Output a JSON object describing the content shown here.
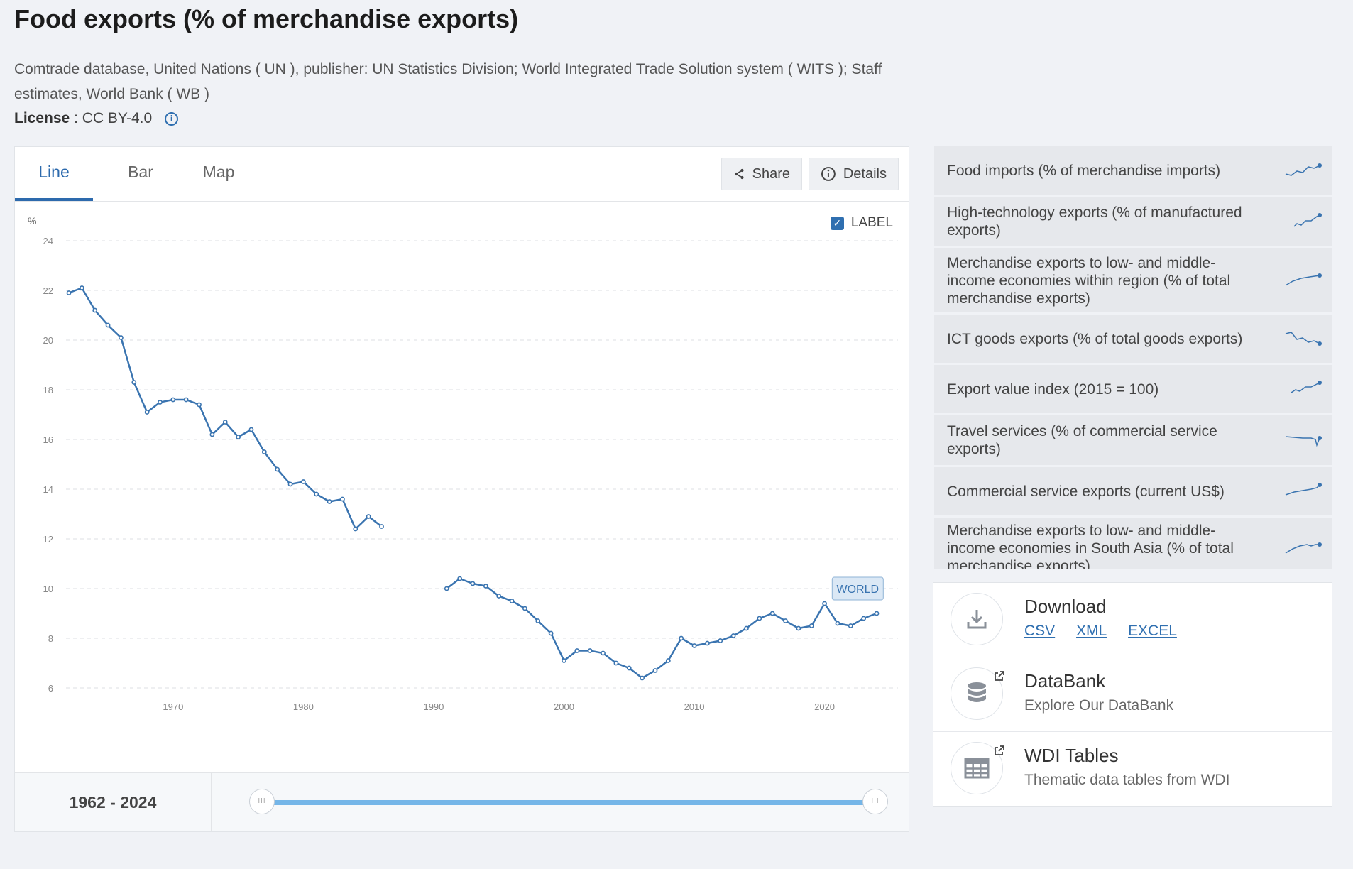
{
  "page": {
    "title": "Food exports (% of merchandise exports)",
    "source": "Comtrade database, United Nations ( UN ), publisher: UN Statistics Division; World Integrated Trade Solution system ( WITS ); Staff estimates, World Bank ( WB )",
    "license_label": "License",
    "license_value": ": CC BY-4.0"
  },
  "tabs": [
    {
      "label": "Line",
      "active": true
    },
    {
      "label": "Bar",
      "active": false
    },
    {
      "label": "Map",
      "active": false
    }
  ],
  "toolbar": {
    "share_label": "Share",
    "details_label": "Details"
  },
  "label_toggle": {
    "label": "LABEL",
    "checked": true
  },
  "range": {
    "start": "1962",
    "sep": " - ",
    "end": "2024"
  },
  "chart_data": {
    "type": "line",
    "ylabel": "%",
    "ylim": [
      6,
      24
    ],
    "yticks": [
      6,
      8,
      10,
      12,
      14,
      16,
      18,
      20,
      22,
      24
    ],
    "xlim": [
      1962,
      2024
    ],
    "xticks": [
      1970,
      1980,
      1990,
      2000,
      2010,
      2020
    ],
    "grid": true,
    "series": [
      {
        "name": "WORLD",
        "color": "#3a74b0",
        "points": [
          [
            1962,
            21.9
          ],
          [
            1963,
            22.1
          ],
          [
            1964,
            21.2
          ],
          [
            1965,
            20.6
          ],
          [
            1966,
            20.1
          ],
          [
            1967,
            18.3
          ],
          [
            1968,
            17.1
          ],
          [
            1969,
            17.5
          ],
          [
            1970,
            17.6
          ],
          [
            1971,
            17.6
          ],
          [
            1972,
            17.4
          ],
          [
            1973,
            16.2
          ],
          [
            1974,
            16.7
          ],
          [
            1975,
            16.1
          ],
          [
            1976,
            16.4
          ],
          [
            1977,
            15.5
          ],
          [
            1978,
            14.8
          ],
          [
            1979,
            14.2
          ],
          [
            1980,
            14.3
          ],
          [
            1981,
            13.8
          ],
          [
            1982,
            13.5
          ],
          [
            1983,
            13.6
          ],
          [
            1984,
            12.4
          ],
          [
            1985,
            12.9
          ],
          [
            1986,
            12.5
          ],
          [
            1987,
            null
          ],
          [
            1988,
            null
          ],
          [
            1989,
            null
          ],
          [
            1990,
            null
          ],
          [
            1991,
            10.0
          ],
          [
            1992,
            10.4
          ],
          [
            1993,
            10.2
          ],
          [
            1994,
            10.1
          ],
          [
            1995,
            9.7
          ],
          [
            1996,
            9.5
          ],
          [
            1997,
            9.2
          ],
          [
            1998,
            8.7
          ],
          [
            1999,
            8.2
          ],
          [
            2000,
            7.1
          ],
          [
            2001,
            7.5
          ],
          [
            2002,
            7.5
          ],
          [
            2003,
            7.4
          ],
          [
            2004,
            7.0
          ],
          [
            2005,
            6.8
          ],
          [
            2006,
            6.4
          ],
          [
            2007,
            6.7
          ],
          [
            2008,
            7.1
          ],
          [
            2009,
            8.0
          ],
          [
            2010,
            7.7
          ],
          [
            2011,
            7.8
          ],
          [
            2012,
            7.9
          ],
          [
            2013,
            8.1
          ],
          [
            2014,
            8.4
          ],
          [
            2015,
            8.8
          ],
          [
            2016,
            9.0
          ],
          [
            2017,
            8.7
          ],
          [
            2018,
            8.4
          ],
          [
            2019,
            8.5
          ],
          [
            2020,
            9.4
          ],
          [
            2021,
            8.6
          ],
          [
            2022,
            8.5
          ],
          [
            2023,
            8.8
          ],
          [
            2024,
            9.0
          ]
        ]
      }
    ]
  },
  "related": [
    {
      "label": "Food imports (% of merchandise imports)",
      "icon": "sparkline-icon"
    },
    {
      "label": "High-technology exports (% of manufactured exports)",
      "icon": "sparkline-icon"
    },
    {
      "label": "Merchandise exports to low- and middle-income economies within region (% of total merchandise exports)",
      "icon": "sparkline-icon"
    },
    {
      "label": "ICT goods exports (% of total goods exports)",
      "icon": "sparkline-icon"
    },
    {
      "label": "Export value index (2015 = 100)",
      "icon": "sparkline-icon"
    },
    {
      "label": "Travel services (% of commercial service exports)",
      "icon": "sparkline-icon"
    },
    {
      "label": "Commercial service exports (current US$)",
      "icon": "sparkline-icon"
    },
    {
      "label": "Merchandise exports to low- and middle-income economies in South Asia (% of total merchandise exports)",
      "icon": "sparkline-icon"
    }
  ],
  "download": {
    "title": "Download",
    "csv": "CSV",
    "xml": "XML",
    "excel": "EXCEL"
  },
  "databank": {
    "title": "DataBank",
    "subtitle": "Explore Our DataBank"
  },
  "wdi": {
    "title": "WDI Tables",
    "subtitle": "Thematic data tables from WDI"
  },
  "colors": {
    "accent": "#2d6aad",
    "line": "#3a74b0",
    "slider": "#75b6e8"
  }
}
